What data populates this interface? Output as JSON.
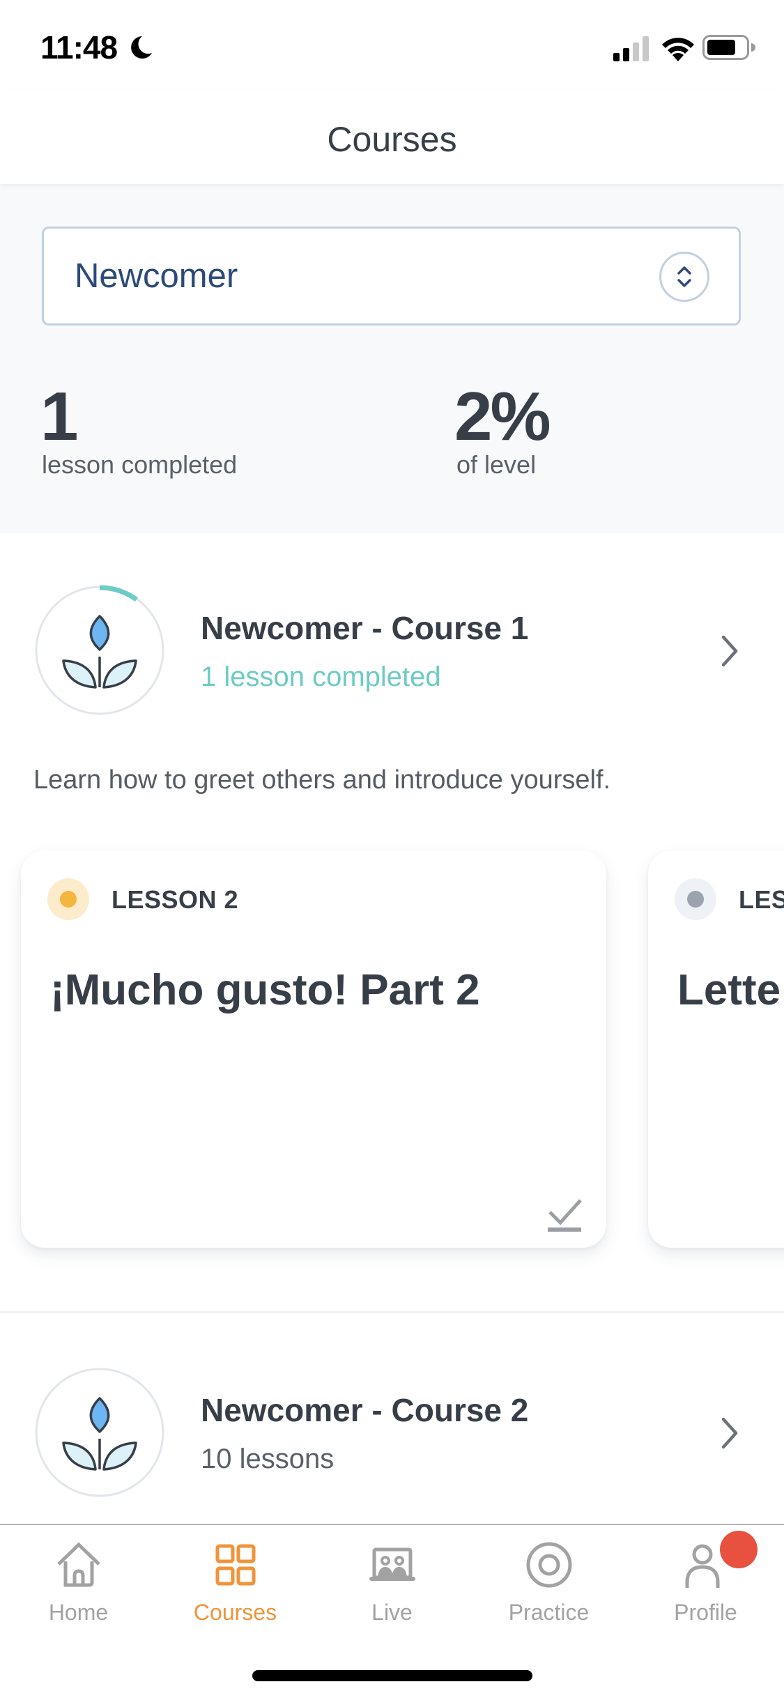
{
  "status_bar": {
    "time": "11:48",
    "do_not_disturb": true,
    "signal_bars": 2,
    "signal_bars_total": 4,
    "battery_level": 0.7
  },
  "header": {
    "title": "Courses"
  },
  "level_selector": {
    "selected": "Newcomer",
    "toggle_icon": "up-down-chevron-icon"
  },
  "stats": {
    "lessons_completed": {
      "value": "1",
      "label": "lesson completed"
    },
    "level_progress": {
      "value": "2%",
      "label": "of level"
    }
  },
  "courses": [
    {
      "title": "Newcomer - Course 1",
      "subtitle": "1 lesson completed",
      "progress": 0.1,
      "description": "Learn how to greet others and introduce yourself.",
      "icon": "sprout-icon",
      "lessons": [
        {
          "label": "LESSON 2",
          "title": "¡Mucho gusto! Part 2",
          "status_color": "#f4b63f",
          "status_bg": "#fdeccb",
          "completed": true
        },
        {
          "label": "LES",
          "title": "Lette",
          "status_color": "#9aa3ae",
          "status_bg": "#eef1f5"
        }
      ]
    },
    {
      "title": "Newcomer - Course 2",
      "subtitle": "10 lessons",
      "progress": 0,
      "icon": "sprout-icon"
    }
  ],
  "tabbar": {
    "active": "Courses",
    "items": [
      {
        "label": "Home",
        "icon": "home-icon"
      },
      {
        "label": "Courses",
        "icon": "grid-icon"
      },
      {
        "label": "Live",
        "icon": "live-class-icon"
      },
      {
        "label": "Practice",
        "icon": "target-icon"
      },
      {
        "label": "Profile",
        "icon": "person-icon",
        "badge": true
      }
    ]
  },
  "colors": {
    "accent": "#f0943a",
    "teal": "#6ccbc5",
    "navy": "#2b4a7b",
    "text": "#373e47",
    "badge": "#e8503f",
    "inactive": "#a2a2a2"
  }
}
